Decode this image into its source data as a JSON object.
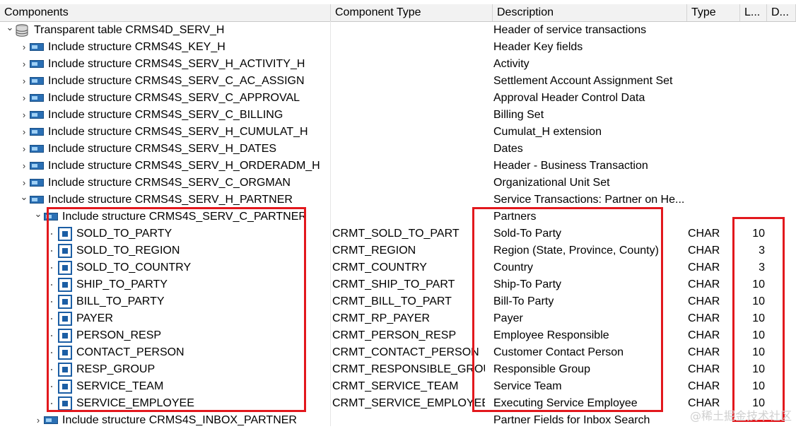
{
  "columns": [
    "Components",
    "Component Type",
    "Description",
    "Type",
    "L...",
    "D..."
  ],
  "rows": [
    {
      "level": 0,
      "toggle": "expanded",
      "icon": "table-icon",
      "name": "Transparent table CRMS4D_SERV_H",
      "comp_type": "",
      "description": "Header of service transactions",
      "type": "",
      "length": ""
    },
    {
      "level": 1,
      "toggle": "collapsed",
      "icon": "structure-icon",
      "name": "Include structure CRMS4S_KEY_H",
      "comp_type": "",
      "description": "Header Key fields",
      "type": "",
      "length": ""
    },
    {
      "level": 1,
      "toggle": "collapsed",
      "icon": "structure-icon",
      "name": "Include structure CRMS4S_SERV_H_ACTIVITY_H",
      "comp_type": "",
      "description": "Activity",
      "type": "",
      "length": ""
    },
    {
      "level": 1,
      "toggle": "collapsed",
      "icon": "structure-icon",
      "name": "Include structure CRMS4S_SERV_C_AC_ASSIGN",
      "comp_type": "",
      "description": "Settlement Account Assignment Set",
      "type": "",
      "length": ""
    },
    {
      "level": 1,
      "toggle": "collapsed",
      "icon": "structure-icon",
      "name": "Include structure CRMS4S_SERV_C_APPROVAL",
      "comp_type": "",
      "description": "Approval Header Control Data",
      "type": "",
      "length": ""
    },
    {
      "level": 1,
      "toggle": "collapsed",
      "icon": "structure-icon",
      "name": "Include structure CRMS4S_SERV_C_BILLING",
      "comp_type": "",
      "description": "Billing Set",
      "type": "",
      "length": ""
    },
    {
      "level": 1,
      "toggle": "collapsed",
      "icon": "structure-icon",
      "name": "Include structure CRMS4S_SERV_H_CUMULAT_H",
      "comp_type": "",
      "description": "Cumulat_H extension",
      "type": "",
      "length": ""
    },
    {
      "level": 1,
      "toggle": "collapsed",
      "icon": "structure-icon",
      "name": "Include structure CRMS4S_SERV_H_DATES",
      "comp_type": "",
      "description": "Dates",
      "type": "",
      "length": ""
    },
    {
      "level": 1,
      "toggle": "collapsed",
      "icon": "structure-icon",
      "name": "Include structure CRMS4S_SERV_H_ORDERADM_H",
      "comp_type": "",
      "description": "Header - Business Transaction",
      "type": "",
      "length": ""
    },
    {
      "level": 1,
      "toggle": "collapsed",
      "icon": "structure-icon",
      "name": "Include structure CRMS4S_SERV_C_ORGMAN",
      "comp_type": "",
      "description": "Organizational Unit Set",
      "type": "",
      "length": ""
    },
    {
      "level": 1,
      "toggle": "expanded",
      "icon": "structure-icon",
      "name": "Include structure CRMS4S_SERV_H_PARTNER",
      "comp_type": "",
      "description": "Service Transactions: Partner on He...",
      "type": "",
      "length": ""
    },
    {
      "level": 2,
      "toggle": "expanded",
      "icon": "structure-icon",
      "name": "Include structure CRMS4S_SERV_C_PARTNER",
      "comp_type": "",
      "description": "Partners",
      "type": "",
      "length": ""
    },
    {
      "level": 3,
      "toggle": "leaf",
      "icon": "field-icon",
      "name": "SOLD_TO_PARTY",
      "comp_type": "CRMT_SOLD_TO_PART",
      "description": "Sold-To Party",
      "type": "CHAR",
      "length": "10"
    },
    {
      "level": 3,
      "toggle": "leaf",
      "icon": "field-icon",
      "name": "SOLD_TO_REGION",
      "comp_type": "CRMT_REGION",
      "description": "Region (State, Province, County)",
      "type": "CHAR",
      "length": "3"
    },
    {
      "level": 3,
      "toggle": "leaf",
      "icon": "field-icon",
      "name": "SOLD_TO_COUNTRY",
      "comp_type": "CRMT_COUNTRY",
      "description": "Country",
      "type": "CHAR",
      "length": "3"
    },
    {
      "level": 3,
      "toggle": "leaf",
      "icon": "field-icon",
      "name": "SHIP_TO_PARTY",
      "comp_type": "CRMT_SHIP_TO_PART",
      "description": "Ship-To Party",
      "type": "CHAR",
      "length": "10"
    },
    {
      "level": 3,
      "toggle": "leaf",
      "icon": "field-icon",
      "name": "BILL_TO_PARTY",
      "comp_type": "CRMT_BILL_TO_PART",
      "description": "Bill-To Party",
      "type": "CHAR",
      "length": "10"
    },
    {
      "level": 3,
      "toggle": "leaf",
      "icon": "field-icon",
      "name": "PAYER",
      "comp_type": "CRMT_RP_PAYER",
      "description": "Payer",
      "type": "CHAR",
      "length": "10"
    },
    {
      "level": 3,
      "toggle": "leaf",
      "icon": "field-icon",
      "name": "PERSON_RESP",
      "comp_type": "CRMT_PERSON_RESP",
      "description": "Employee Responsible",
      "type": "CHAR",
      "length": "10"
    },
    {
      "level": 3,
      "toggle": "leaf",
      "icon": "field-icon",
      "name": "CONTACT_PERSON",
      "comp_type": "CRMT_CONTACT_PERSON",
      "description": "Customer Contact Person",
      "type": "CHAR",
      "length": "10"
    },
    {
      "level": 3,
      "toggle": "leaf",
      "icon": "field-icon",
      "name": "RESP_GROUP",
      "comp_type": "CRMT_RESPONSIBLE_GROUP",
      "description": "Responsible Group",
      "type": "CHAR",
      "length": "10"
    },
    {
      "level": 3,
      "toggle": "leaf",
      "icon": "field-icon",
      "name": "SERVICE_TEAM",
      "comp_type": "CRMT_SERVICE_TEAM",
      "description": "Service Team",
      "type": "CHAR",
      "length": "10"
    },
    {
      "level": 3,
      "toggle": "leaf",
      "icon": "field-icon",
      "name": "SERVICE_EMPLOYEE",
      "comp_type": "CRMT_SERVICE_EMPLOYEE",
      "description": "Executing Service Employee",
      "type": "CHAR",
      "length": "10"
    },
    {
      "level": 2,
      "toggle": "collapsed",
      "icon": "structure-icon",
      "name": "Include structure CRMS4S_INBOX_PARTNER",
      "comp_type": "",
      "description": "Partner Fields for Inbox Search",
      "type": "",
      "length": ""
    }
  ],
  "highlight_color": "#e2181d",
  "watermark": "@稀土掘金技术社区"
}
